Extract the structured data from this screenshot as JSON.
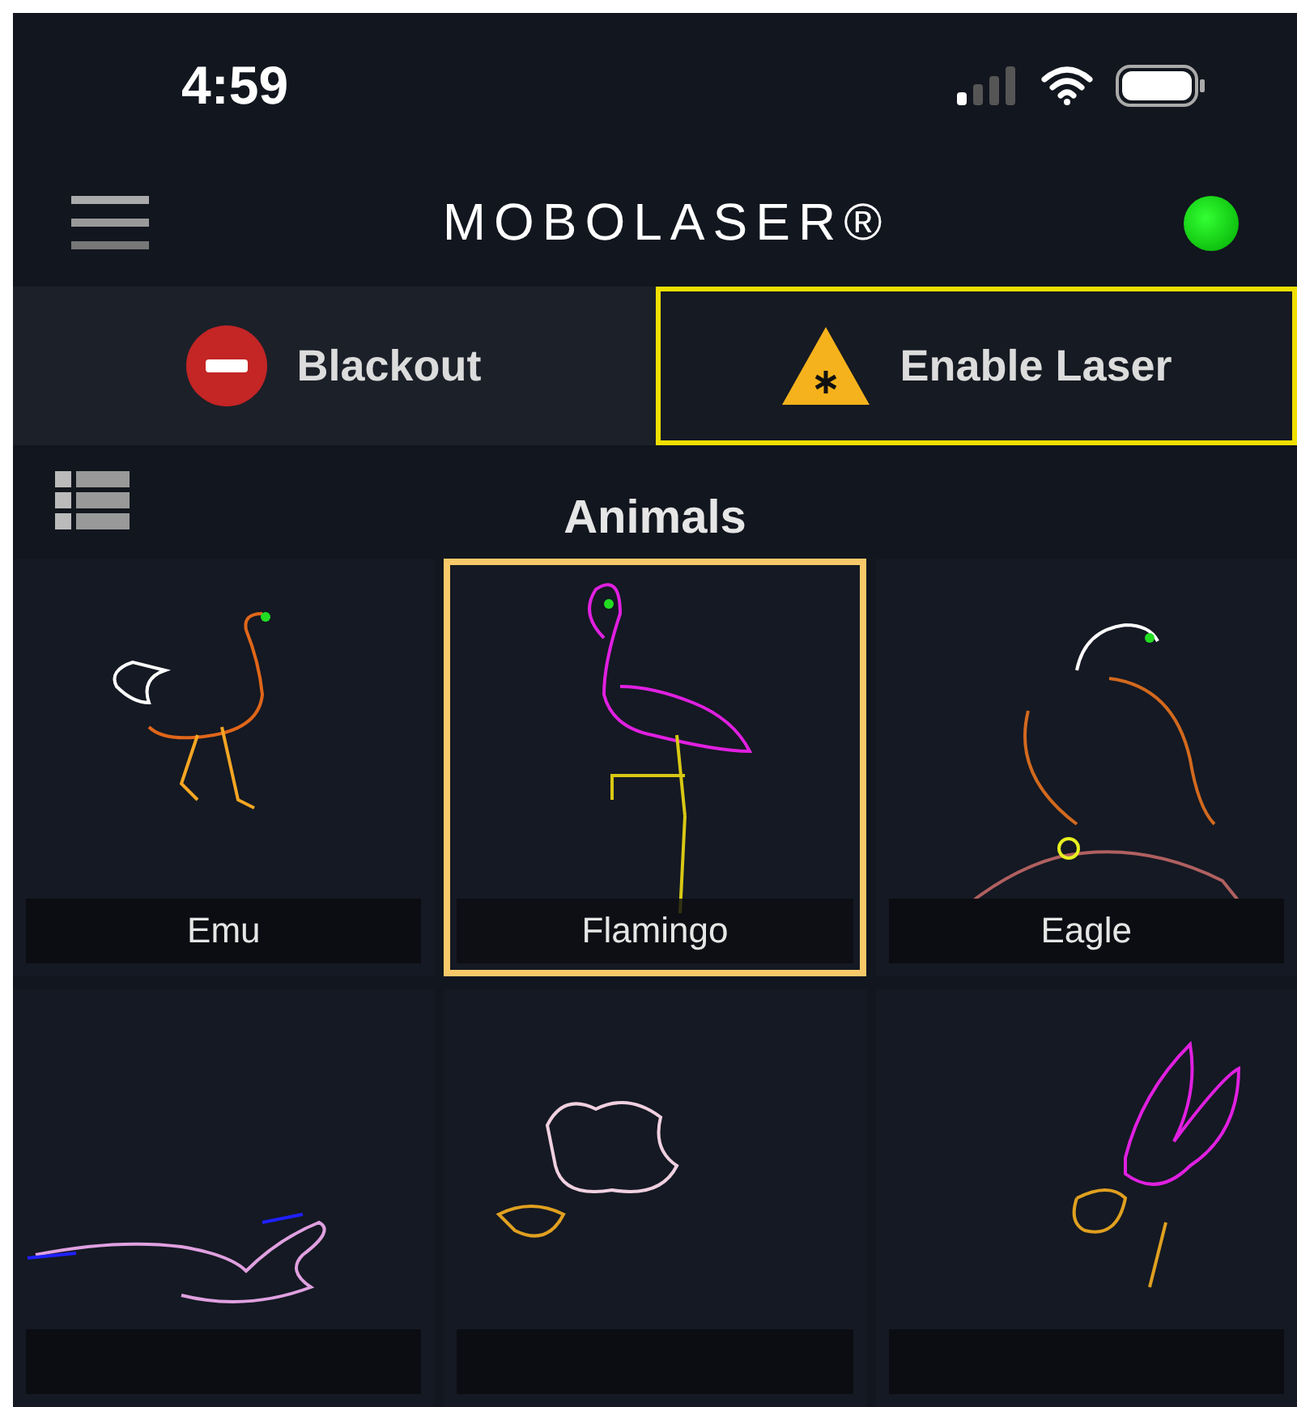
{
  "status_bar": {
    "time": "4:59"
  },
  "header": {
    "title": "MOBOLASER®",
    "connected": true
  },
  "actions": [
    {
      "kind": "blackout",
      "label": "Blackout",
      "selected": false
    },
    {
      "kind": "laser",
      "label": "Enable Laser",
      "selected": true
    }
  ],
  "category": {
    "title": "Animals"
  },
  "tiles": [
    {
      "label": "Emu",
      "selected": false
    },
    {
      "label": "Flamingo",
      "selected": true
    },
    {
      "label": "Eagle",
      "selected": false
    },
    {
      "selected": false
    },
    {
      "selected": false
    },
    {
      "selected": false
    }
  ]
}
